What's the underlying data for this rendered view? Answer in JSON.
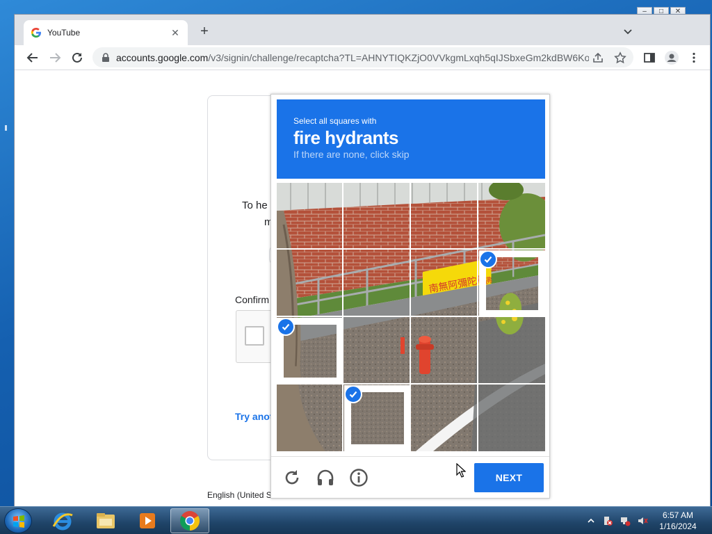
{
  "browser": {
    "tab_title": "YouTube",
    "url_host": "accounts.google.com",
    "url_path": "/v3/signin/challenge/recaptcha?TL=AHNYTIQKZjO0VVkgmLxqh5qIJSbxeGm2kdBW6Ko..."
  },
  "background_page": {
    "text_fragment_1": "To he",
    "text_fragment_2": "m",
    "text_fragment_3": "Confirm",
    "link_fragment": "Try anot",
    "footer_language": "English (United S"
  },
  "captcha": {
    "instruction_prefix": "Select all squares with",
    "target": "fire hydrants",
    "hint": "If there are none, click skip",
    "selected_tiles": [
      7,
      8,
      13
    ],
    "next_label": "NEXT"
  },
  "taskbar": {
    "time": "6:57 AM",
    "date": "1/16/2024"
  },
  "colors": {
    "captcha_blue": "#1a73e8",
    "chrome_tabstrip": "#dee1e6"
  }
}
